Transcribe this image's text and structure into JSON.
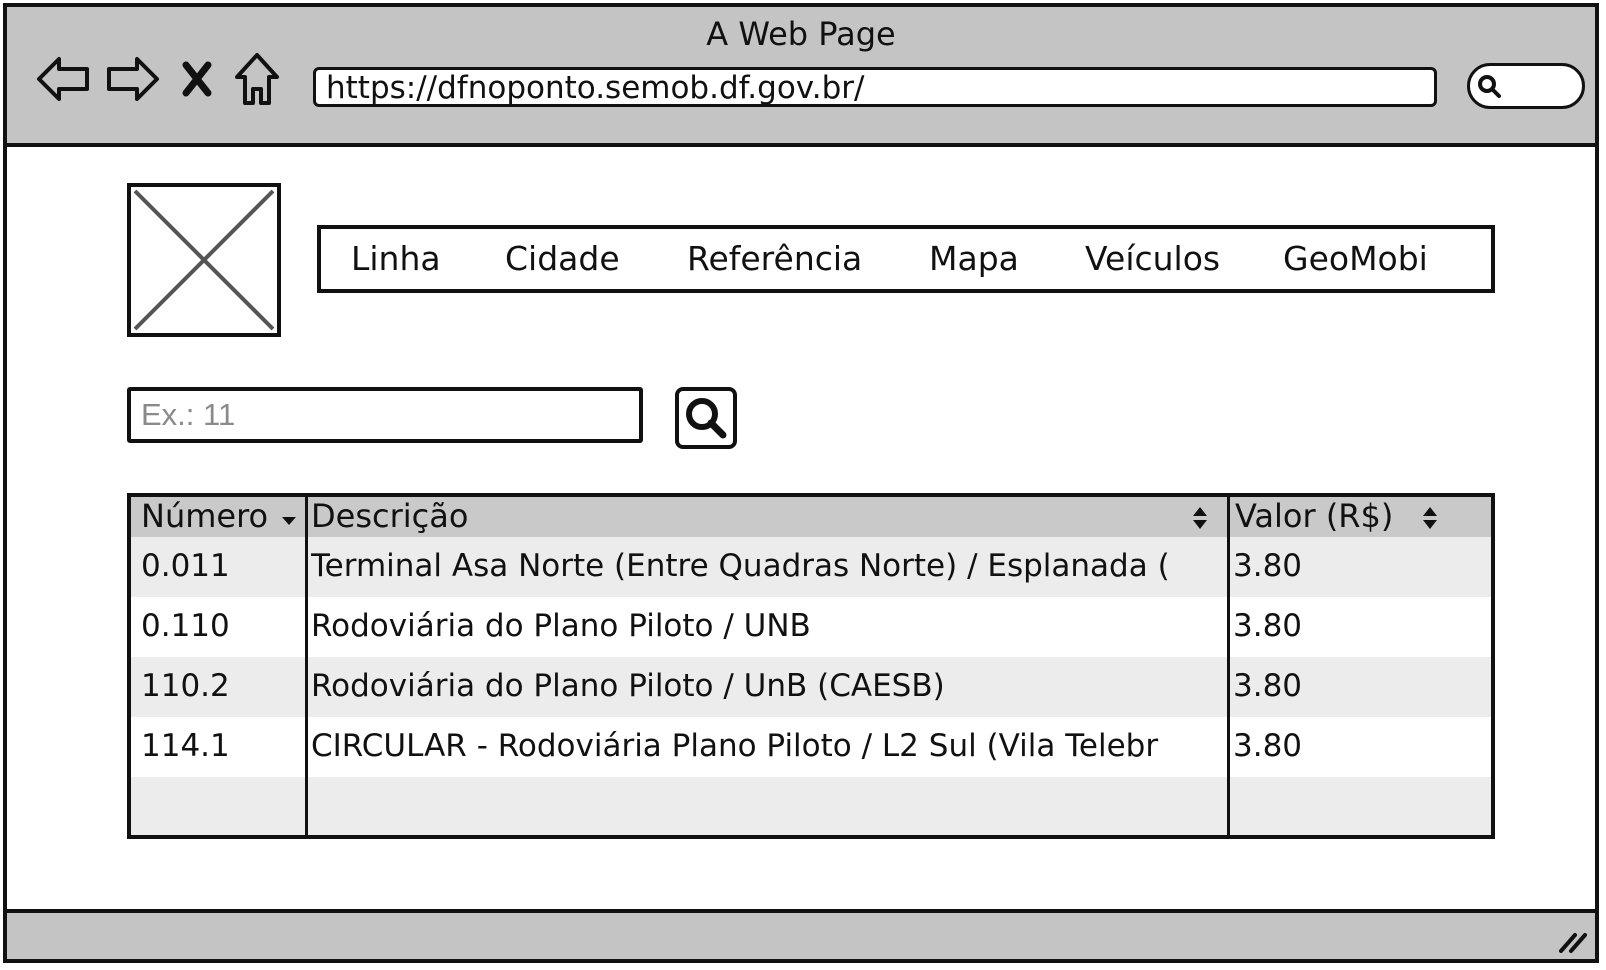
{
  "window": {
    "title": "A Web Page"
  },
  "browser": {
    "url": "https://dfnoponto.semob.df.gov.br/",
    "icons": [
      "back-arrow-icon",
      "forward-arrow-icon",
      "close-x-icon",
      "home-icon",
      "search-icon"
    ]
  },
  "nav": {
    "items": [
      {
        "label": "Linha"
      },
      {
        "label": "Cidade"
      },
      {
        "label": "Referência"
      },
      {
        "label": "Mapa"
      },
      {
        "label": "Veículos"
      },
      {
        "label": "GeoMobi"
      }
    ]
  },
  "search": {
    "placeholder": "Ex.: 11"
  },
  "table": {
    "headers": {
      "numero": "Número",
      "descricao": "Descrição",
      "valor": "Valor (R$)"
    },
    "sort": {
      "numero": "descending",
      "descricao": "sortable",
      "valor": "sortable"
    },
    "rows": [
      {
        "numero": "0.011",
        "descricao": "Terminal Asa Norte (Entre Quadras Norte) / Esplanada (",
        "valor": "3.80"
      },
      {
        "numero": "0.110",
        "descricao": "Rodoviária do Plano Piloto / UNB",
        "valor": "3.80"
      },
      {
        "numero": "110.2",
        "descricao": "Rodoviária do Plano Piloto / UnB (CAESB)",
        "valor": "3.80"
      },
      {
        "numero": "114.1",
        "descricao": "CIRCULAR - Rodoviária Plano Piloto / L2 Sul (Vila Telebr",
        "valor": "3.80"
      }
    ]
  },
  "colors": {
    "chrome": "#c4c4c4",
    "header": "#c9c9c9",
    "stripe": "#ececec",
    "ink": "#111111"
  }
}
